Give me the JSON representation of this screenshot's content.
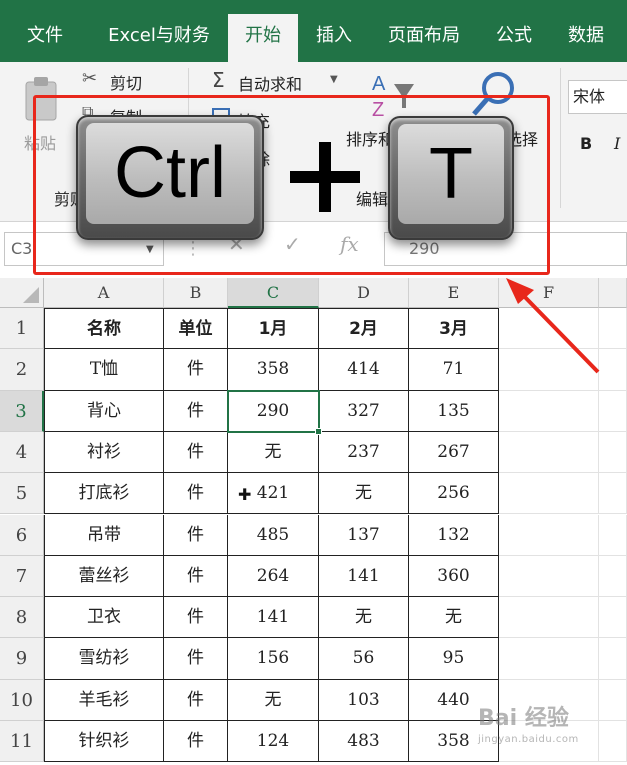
{
  "tabs": [
    {
      "label": "文件",
      "active": false
    },
    {
      "label": "Excel与财务",
      "active": false
    },
    {
      "label": "开始",
      "active": true
    },
    {
      "label": "插入",
      "active": false
    },
    {
      "label": "页面布局",
      "active": false
    },
    {
      "label": "公式",
      "active": false
    },
    {
      "label": "数据",
      "active": false
    }
  ],
  "ribbon": {
    "clipboard": {
      "paste": "粘贴",
      "cut": "剪切",
      "copy": "复制",
      "group": "剪贴板"
    },
    "editing": {
      "autosum": "自动求和",
      "fill": "填充",
      "clear": "清除",
      "sort": "排序和筛选",
      "find": "查找和选择",
      "group": "编辑"
    },
    "font": {
      "name": "宋体",
      "bold": "B",
      "italic": "I"
    }
  },
  "formula_bar": {
    "name_box": "C3",
    "formula": "290",
    "cancel": "✕",
    "confirm": "✓",
    "fx": "fx"
  },
  "shortcut": {
    "key1": "Ctrl",
    "plus": "+",
    "key2": "T"
  },
  "columns": [
    "A",
    "B",
    "C",
    "D",
    "E",
    "F"
  ],
  "rows": [
    "1",
    "2",
    "3",
    "4",
    "5",
    "6",
    "7",
    "8",
    "9",
    "10",
    "11"
  ],
  "selected_cell": "C3",
  "table": {
    "header": [
      "名称",
      "单位",
      "1月",
      "2月",
      "3月"
    ],
    "rows": [
      [
        "T恤",
        "件",
        "358",
        "414",
        "71"
      ],
      [
        "背心",
        "件",
        "290",
        "327",
        "135"
      ],
      [
        "衬衫",
        "件",
        "无",
        "237",
        "267"
      ],
      [
        "打底衫",
        "件",
        "421",
        "无",
        "256"
      ],
      [
        "吊带",
        "件",
        "485",
        "137",
        "132"
      ],
      [
        "蕾丝衫",
        "件",
        "264",
        "141",
        "360"
      ],
      [
        "卫衣",
        "件",
        "141",
        "无",
        "无"
      ],
      [
        "雪纺衫",
        "件",
        "156",
        "56",
        "95"
      ],
      [
        "羊毛衫",
        "件",
        "无",
        "103",
        "440"
      ],
      [
        "针织衫",
        "件",
        "124",
        "483",
        "358"
      ]
    ]
  },
  "colors": {
    "accent": "#217346",
    "highlight": "#e8271b"
  },
  "watermark": {
    "main": "Bai 经验",
    "sub": "jingyan.baidu.com"
  }
}
